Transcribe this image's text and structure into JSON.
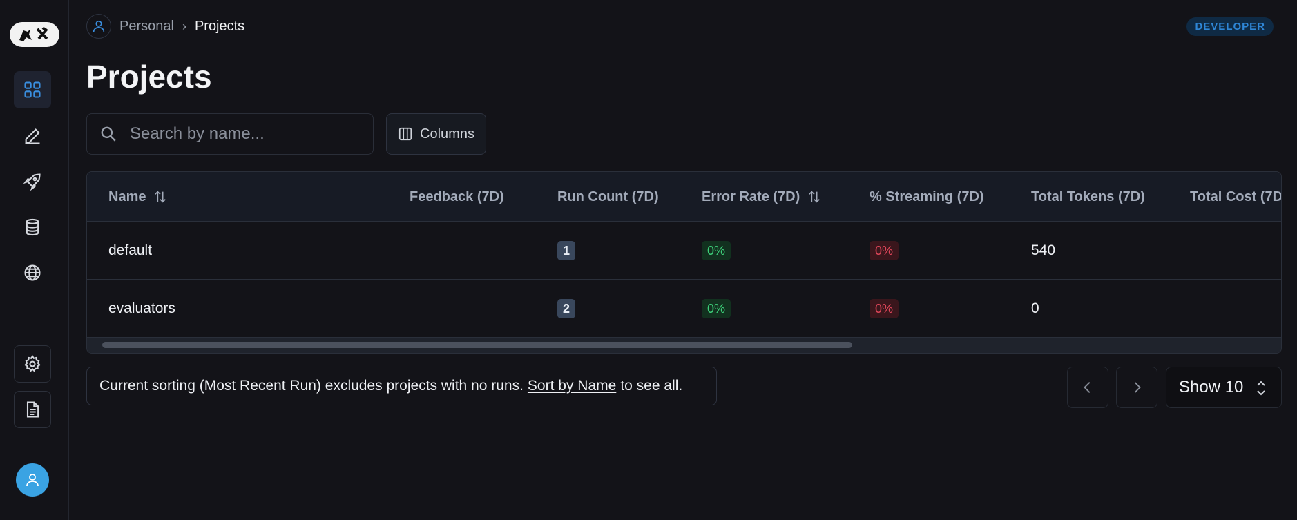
{
  "sidebar": {
    "logo_text": "🦜🛠",
    "items": [
      {
        "icon": "grid-icon",
        "active": true
      },
      {
        "icon": "pen-icon"
      },
      {
        "icon": "rocket-icon"
      },
      {
        "icon": "database-icon"
      },
      {
        "icon": "globe-icon"
      },
      {
        "icon": "gear-icon"
      },
      {
        "icon": "document-icon"
      }
    ],
    "avatar_icon": "user-icon"
  },
  "header": {
    "breadcrumb": {
      "root": "Personal",
      "separator": "›",
      "current": "Projects"
    },
    "badge": "DEVELOPER",
    "title": "Projects"
  },
  "toolbar": {
    "search_placeholder": "Search by name...",
    "columns_label": "Columns"
  },
  "table": {
    "columns": [
      "Name",
      "Feedback (7D)",
      "Run Count (7D)",
      "Error Rate (7D)",
      "% Streaming (7D)",
      "Total Tokens (7D)",
      "Total Cost (7D"
    ],
    "rows": [
      {
        "name": "default",
        "run_count": "1",
        "error_rate": "0%",
        "streaming": "0%",
        "total_tokens": "540"
      },
      {
        "name": "evaluators",
        "run_count": "2",
        "error_rate": "0%",
        "streaming": "0%",
        "total_tokens": "0"
      }
    ]
  },
  "footer": {
    "notice_before": "Current sorting (Most Recent Run) excludes projects with no runs.",
    "notice_link": "Sort by Name",
    "notice_after": "to see all.",
    "show_label": "Show 10"
  },
  "colors": {
    "background": "#131318",
    "accent_blue": "#3a8fe0",
    "success_green": "#3ed07a",
    "error_red": "#e0465a",
    "avatar": "#3aa3e3"
  }
}
